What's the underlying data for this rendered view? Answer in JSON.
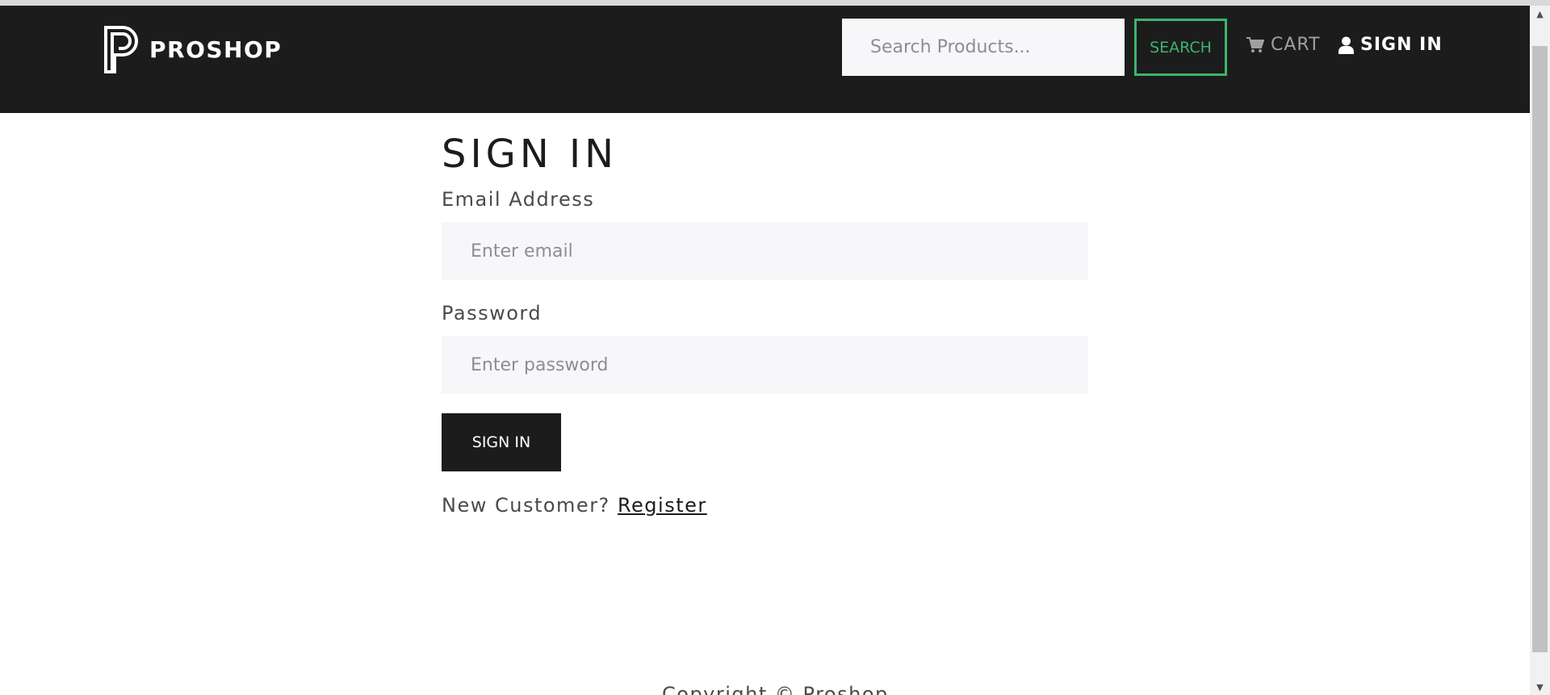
{
  "header": {
    "brand": "PROSHOP",
    "search": {
      "placeholder": "Search Products...",
      "value": ""
    },
    "search_button": "SEARCH",
    "cart_label": "CART",
    "signin_label": "SIGN IN"
  },
  "form": {
    "title": "SIGN IN",
    "email": {
      "label": "Email Address",
      "placeholder": "Enter email",
      "value": ""
    },
    "password": {
      "label": "Password",
      "placeholder": "Enter password",
      "value": ""
    },
    "submit_label": "SIGN IN",
    "new_customer_prompt": "New Customer?",
    "register_link": "Register"
  },
  "footer": {
    "copyright": "Copyright © Proshop"
  },
  "colors": {
    "navbar_bg": "#1c1c1c",
    "accent_green": "#3cb46e",
    "input_bg": "#f7f7f9",
    "button_bg": "#1c1c1c"
  },
  "icons": [
    "proshop-logo-icon",
    "cart-icon",
    "user-icon",
    "scroll-up-arrow-icon",
    "scroll-down-arrow-icon"
  ]
}
